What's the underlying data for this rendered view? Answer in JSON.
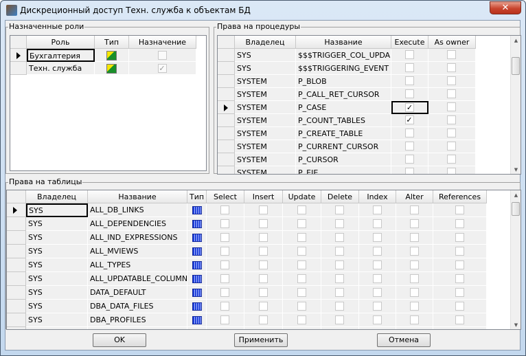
{
  "window": {
    "title": "Дискреционный доступ Техн. служба к объектам БД",
    "close_icon": "close-icon"
  },
  "roles": {
    "label": "Назначенные роли",
    "columns": [
      "Роль",
      "Тип",
      "Назначение"
    ],
    "rows": [
      {
        "role": "Бухгалтерия",
        "type_icon": "role-icon",
        "assigned": false,
        "current": true
      },
      {
        "role": "Техн. служба",
        "type_icon": "role-icon",
        "assigned": true,
        "current": false
      }
    ]
  },
  "procedures": {
    "label": "Права на процедуры",
    "columns": [
      "Владелец",
      "Название",
      "Execute",
      "As owner"
    ],
    "rows": [
      {
        "owner": "SYS",
        "name": "$$$TRIGGER_COL_UPDA",
        "execute": false,
        "as_owner": false
      },
      {
        "owner": "SYS",
        "name": "$$$TRIGGERING_EVENT",
        "execute": false,
        "as_owner": false
      },
      {
        "owner": "SYSTEM",
        "name": "P_BLOB",
        "execute": false,
        "as_owner": false
      },
      {
        "owner": "SYSTEM",
        "name": "P_CALL_RET_CURSOR",
        "execute": false,
        "as_owner": false
      },
      {
        "owner": "SYSTEM",
        "name": "P_CASE",
        "execute": true,
        "as_owner": false,
        "current": true
      },
      {
        "owner": "SYSTEM",
        "name": "P_COUNT_TABLES",
        "execute": true,
        "as_owner": false
      },
      {
        "owner": "SYSTEM",
        "name": "P_CREATE_TABLE",
        "execute": false,
        "as_owner": false
      },
      {
        "owner": "SYSTEM",
        "name": "P_CURRENT_CURSOR",
        "execute": false,
        "as_owner": false
      },
      {
        "owner": "SYSTEM",
        "name": "P_CURSOR",
        "execute": false,
        "as_owner": false
      },
      {
        "owner": "SYSTEM",
        "name": "P_EIE",
        "execute": false,
        "as_owner": false
      }
    ]
  },
  "tables": {
    "label": "Права на таблицы",
    "columns": [
      "Владелец",
      "Название",
      "Тип",
      "Select",
      "Insert",
      "Update",
      "Delete",
      "Index",
      "Alter",
      "References"
    ],
    "rows": [
      {
        "owner": "SYS",
        "name": "ALL_DB_LINKS",
        "current": true
      },
      {
        "owner": "SYS",
        "name": "ALL_DEPENDENCIES"
      },
      {
        "owner": "SYS",
        "name": "ALL_IND_EXPRESSIONS"
      },
      {
        "owner": "SYS",
        "name": "ALL_MVIEWS"
      },
      {
        "owner": "SYS",
        "name": "ALL_TYPES"
      },
      {
        "owner": "SYS",
        "name": "ALL_UPDATABLE_COLUMNS"
      },
      {
        "owner": "SYS",
        "name": "DATA_DEFAULT"
      },
      {
        "owner": "SYS",
        "name": "DBA_DATA_FILES"
      },
      {
        "owner": "SYS",
        "name": "DBA_PROFILES"
      },
      {
        "owner": "",
        "name": ""
      }
    ],
    "type_icon": "table-icon"
  },
  "buttons": {
    "ok": "OK",
    "apply": "Применить",
    "cancel": "Отмена"
  }
}
